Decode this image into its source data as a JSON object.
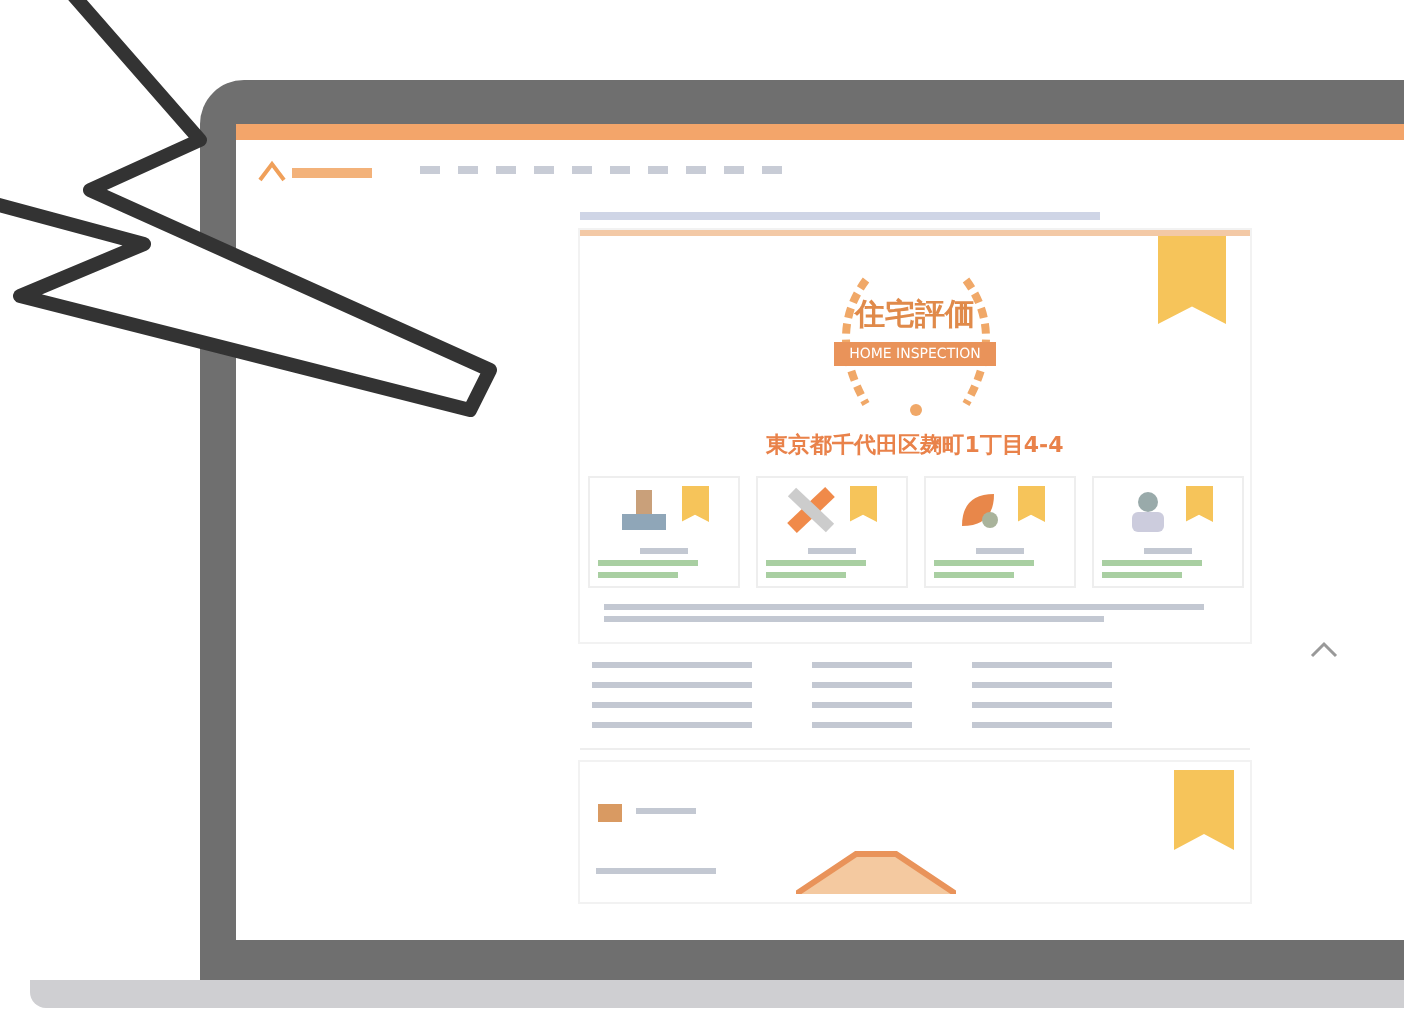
{
  "emblem": {
    "title": "住宅評価",
    "ribbon": "HOME INSPECTION"
  },
  "address": "東京都千代田区麹町1丁目4-4",
  "feature_cards": [
    {
      "kind": "foundation"
    },
    {
      "kind": "repair"
    },
    {
      "kind": "leaf"
    },
    {
      "kind": "inspector"
    }
  ]
}
